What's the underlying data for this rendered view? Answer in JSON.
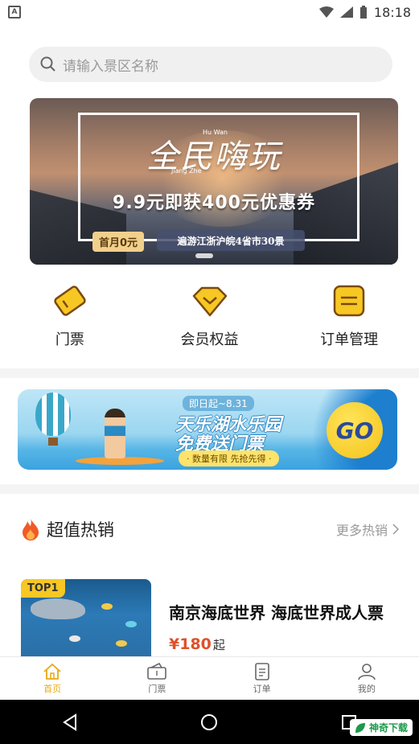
{
  "status_bar": {
    "time": "18:18"
  },
  "search": {
    "placeholder": "请输入景区名称"
  },
  "banner": {
    "title": "全民嗨玩",
    "english_1": "Hu Wan",
    "english_2": "Jiang Zhe",
    "offer": "9.9元即获400元优惠券",
    "first_month": "首月0元",
    "tour": "遍游江浙沪皖4省市30景"
  },
  "quick_entries": [
    {
      "label": "门票",
      "icon": "ticket-icon"
    },
    {
      "label": "会员权益",
      "icon": "member-diamond-icon"
    },
    {
      "label": "订单管理",
      "icon": "order-list-icon"
    }
  ],
  "promo": {
    "date": "即日起~8.31",
    "title": "天乐湖水乐园",
    "subtitle": "免费送门票",
    "tag": "· 数量有限 先抢先得 ·",
    "go": "GO"
  },
  "hot": {
    "title": "超值热销",
    "more": "更多热销"
  },
  "product": {
    "badge": "TOP1",
    "name": "南京海底世界 海底世界成人票",
    "price": "¥180",
    "price_suffix": "起"
  },
  "bottom_nav": [
    {
      "label": "首页",
      "icon": "home-icon",
      "active": true
    },
    {
      "label": "门票",
      "icon": "ticket-icon",
      "active": false
    },
    {
      "label": "订单",
      "icon": "order-icon",
      "active": false
    },
    {
      "label": "我的",
      "icon": "profile-icon",
      "active": false
    }
  ],
  "watermark": {
    "text": "神奇下载"
  },
  "colors": {
    "accent": "#e8a915",
    "price": "#e0502a",
    "badge": "#f7c724"
  }
}
